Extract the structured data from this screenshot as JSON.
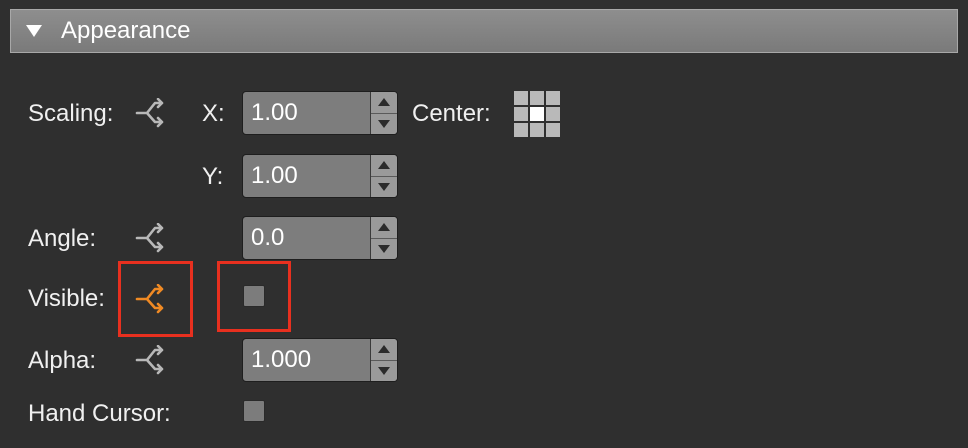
{
  "header": {
    "title": "Appearance"
  },
  "scaling": {
    "label": "Scaling:",
    "x_label": "X:",
    "x_value": "1.00",
    "y_label": "Y:",
    "y_value": "1.00",
    "center_label": "Center:"
  },
  "angle": {
    "label": "Angle:",
    "value": "0.0"
  },
  "visible": {
    "label": "Visible:",
    "checked": false
  },
  "alpha": {
    "label": "Alpha:",
    "value": "1.000"
  },
  "hand_cursor": {
    "label": "Hand Cursor:",
    "checked": false
  },
  "colors": {
    "link_default": "#b8b8b8",
    "link_active": "#f08a24",
    "highlight": "#e8301f"
  }
}
